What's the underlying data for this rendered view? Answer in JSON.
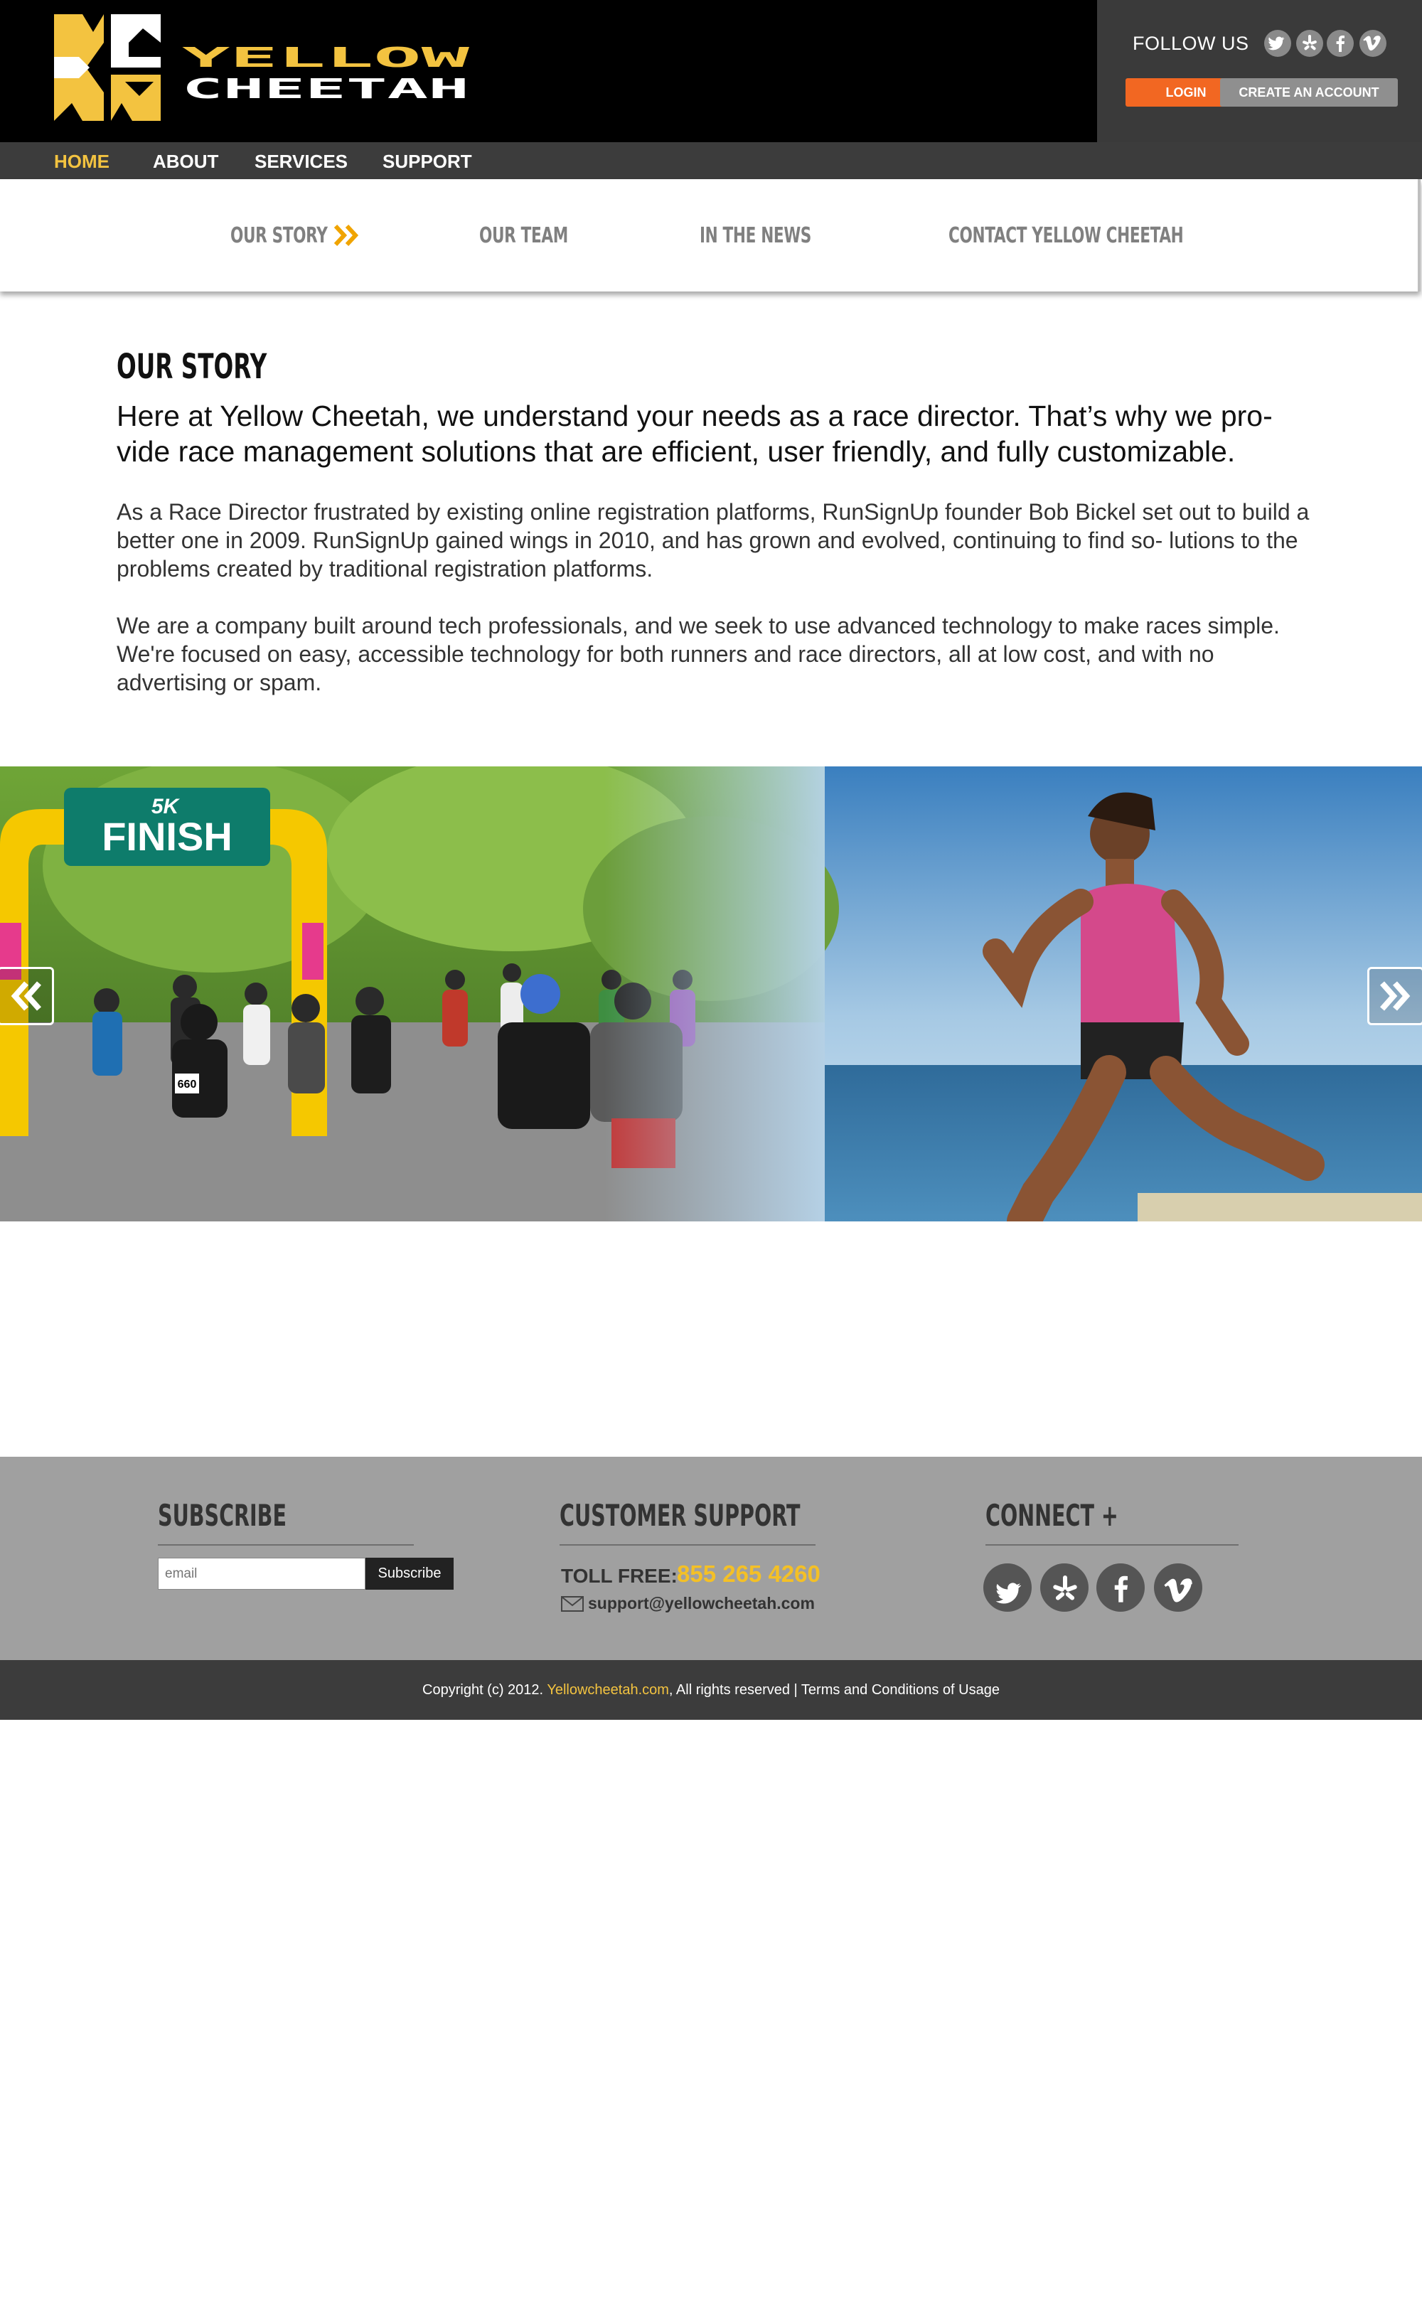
{
  "brand": {
    "wordmark_line1": "YELLOW",
    "wordmark_line2": "CHEETAH",
    "accent_color": "#f3c340",
    "orange_color": "#f26722"
  },
  "header": {
    "follow_label": "FOLLOW US",
    "social": [
      {
        "icon": "twitter-icon"
      },
      {
        "icon": "yelp-icon"
      },
      {
        "icon": "facebook-icon"
      },
      {
        "icon": "vimeo-icon"
      }
    ],
    "login_label": "LOGIN",
    "create_account_label": "CREATE AN ACCOUNT"
  },
  "nav": {
    "items": [
      {
        "label": "HOME",
        "active": true
      },
      {
        "label": "ABOUT"
      },
      {
        "label": "SERVICES"
      },
      {
        "label": "SUPPORT"
      }
    ]
  },
  "subnav": {
    "items": [
      {
        "label": "OUR STORY",
        "active": true
      },
      {
        "label": "OUR TEAM"
      },
      {
        "label": "IN THE NEWS"
      },
      {
        "label": "CONTACT YELLOW CHEETAH"
      }
    ]
  },
  "story": {
    "heading": "OUR STORY",
    "lead": "Here at Yellow Cheetah, we understand your needs as a race director. That’s why we pro- vide race management solutions that are efficient, user friendly, and fully customizable.",
    "paragraph1": "As a Race Director frustrated by existing online registration platforms, RunSignUp founder Bob Bickel set out to build a better one in 2009. RunSignUp gained wings in 2010, and has grown and evolved, continuing to find so- lutions to the problems created by traditional registration platforms.",
    "paragraph2": "We are a company built around tech professionals, and we seek to use advanced technology to make races simple. We're focused on easy, accessible technology for both runners and race directors, all at low cost, and with no advertising or spam."
  },
  "banner": {
    "finish_text": "FINISH",
    "badge_text": "5K",
    "bib_text": "660"
  },
  "footer": {
    "subscribe": {
      "heading": "SUBSCRIBE",
      "input_placeholder": "email",
      "button_label": "Subscribe"
    },
    "support": {
      "heading": "CUSTOMER SUPPORT",
      "toll_label": "TOLL FREE:",
      "toll_number": "855 265 4260",
      "email": "support@yellowcheetah.com"
    },
    "connect": {
      "heading": "CONNECT +",
      "social": [
        {
          "icon": "twitter-icon"
        },
        {
          "icon": "yelp-icon"
        },
        {
          "icon": "facebook-icon"
        },
        {
          "icon": "vimeo-icon"
        }
      ]
    },
    "copyright_prefix": "Copyright (c) 2012. ",
    "copyright_site": "Yellowcheetah.com",
    "copyright_suffix": ", All rights reserved | Terms and Conditions of Usage"
  }
}
